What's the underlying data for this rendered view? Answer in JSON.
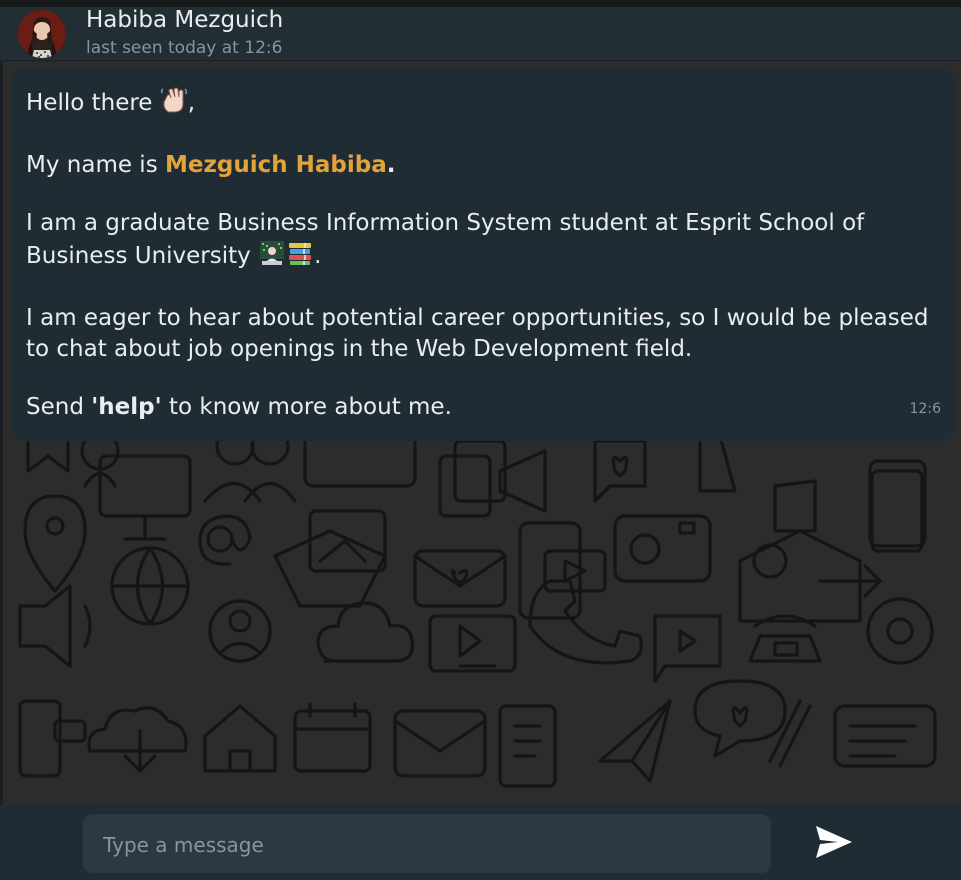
{
  "header": {
    "contact_name": "Habiba Mezguich",
    "last_seen_prefix": "last seen today at ",
    "last_seen_time": "12:6"
  },
  "message": {
    "greeting": "Hello there",
    "greeting_emoji": "waving-hand",
    "greeting_suffix": ",",
    "name_prefix": "My name is ",
    "name_highlight": "Mezguich Habiba",
    "name_suffix": ".",
    "education": "I am a graduate Business Information System student at Esprit School of Business University",
    "education_emojis": [
      "student-at-computer",
      "books"
    ],
    "education_suffix": ".",
    "career": "I am eager to hear about potential career opportunities, so I would be pleased to chat about job openings in the Web Development field.",
    "help_prefix": "Send ",
    "help_keyword": "'help'",
    "help_suffix": " to know more about me.",
    "time": "12:6"
  },
  "composer": {
    "placeholder": "Type a message",
    "send_icon": "send-icon"
  },
  "colors": {
    "header_bg": "#222d34",
    "bubble_bg": "#202c33",
    "highlight": "#e2a33a",
    "text": "#e9edef",
    "muted": "#8696a0"
  }
}
